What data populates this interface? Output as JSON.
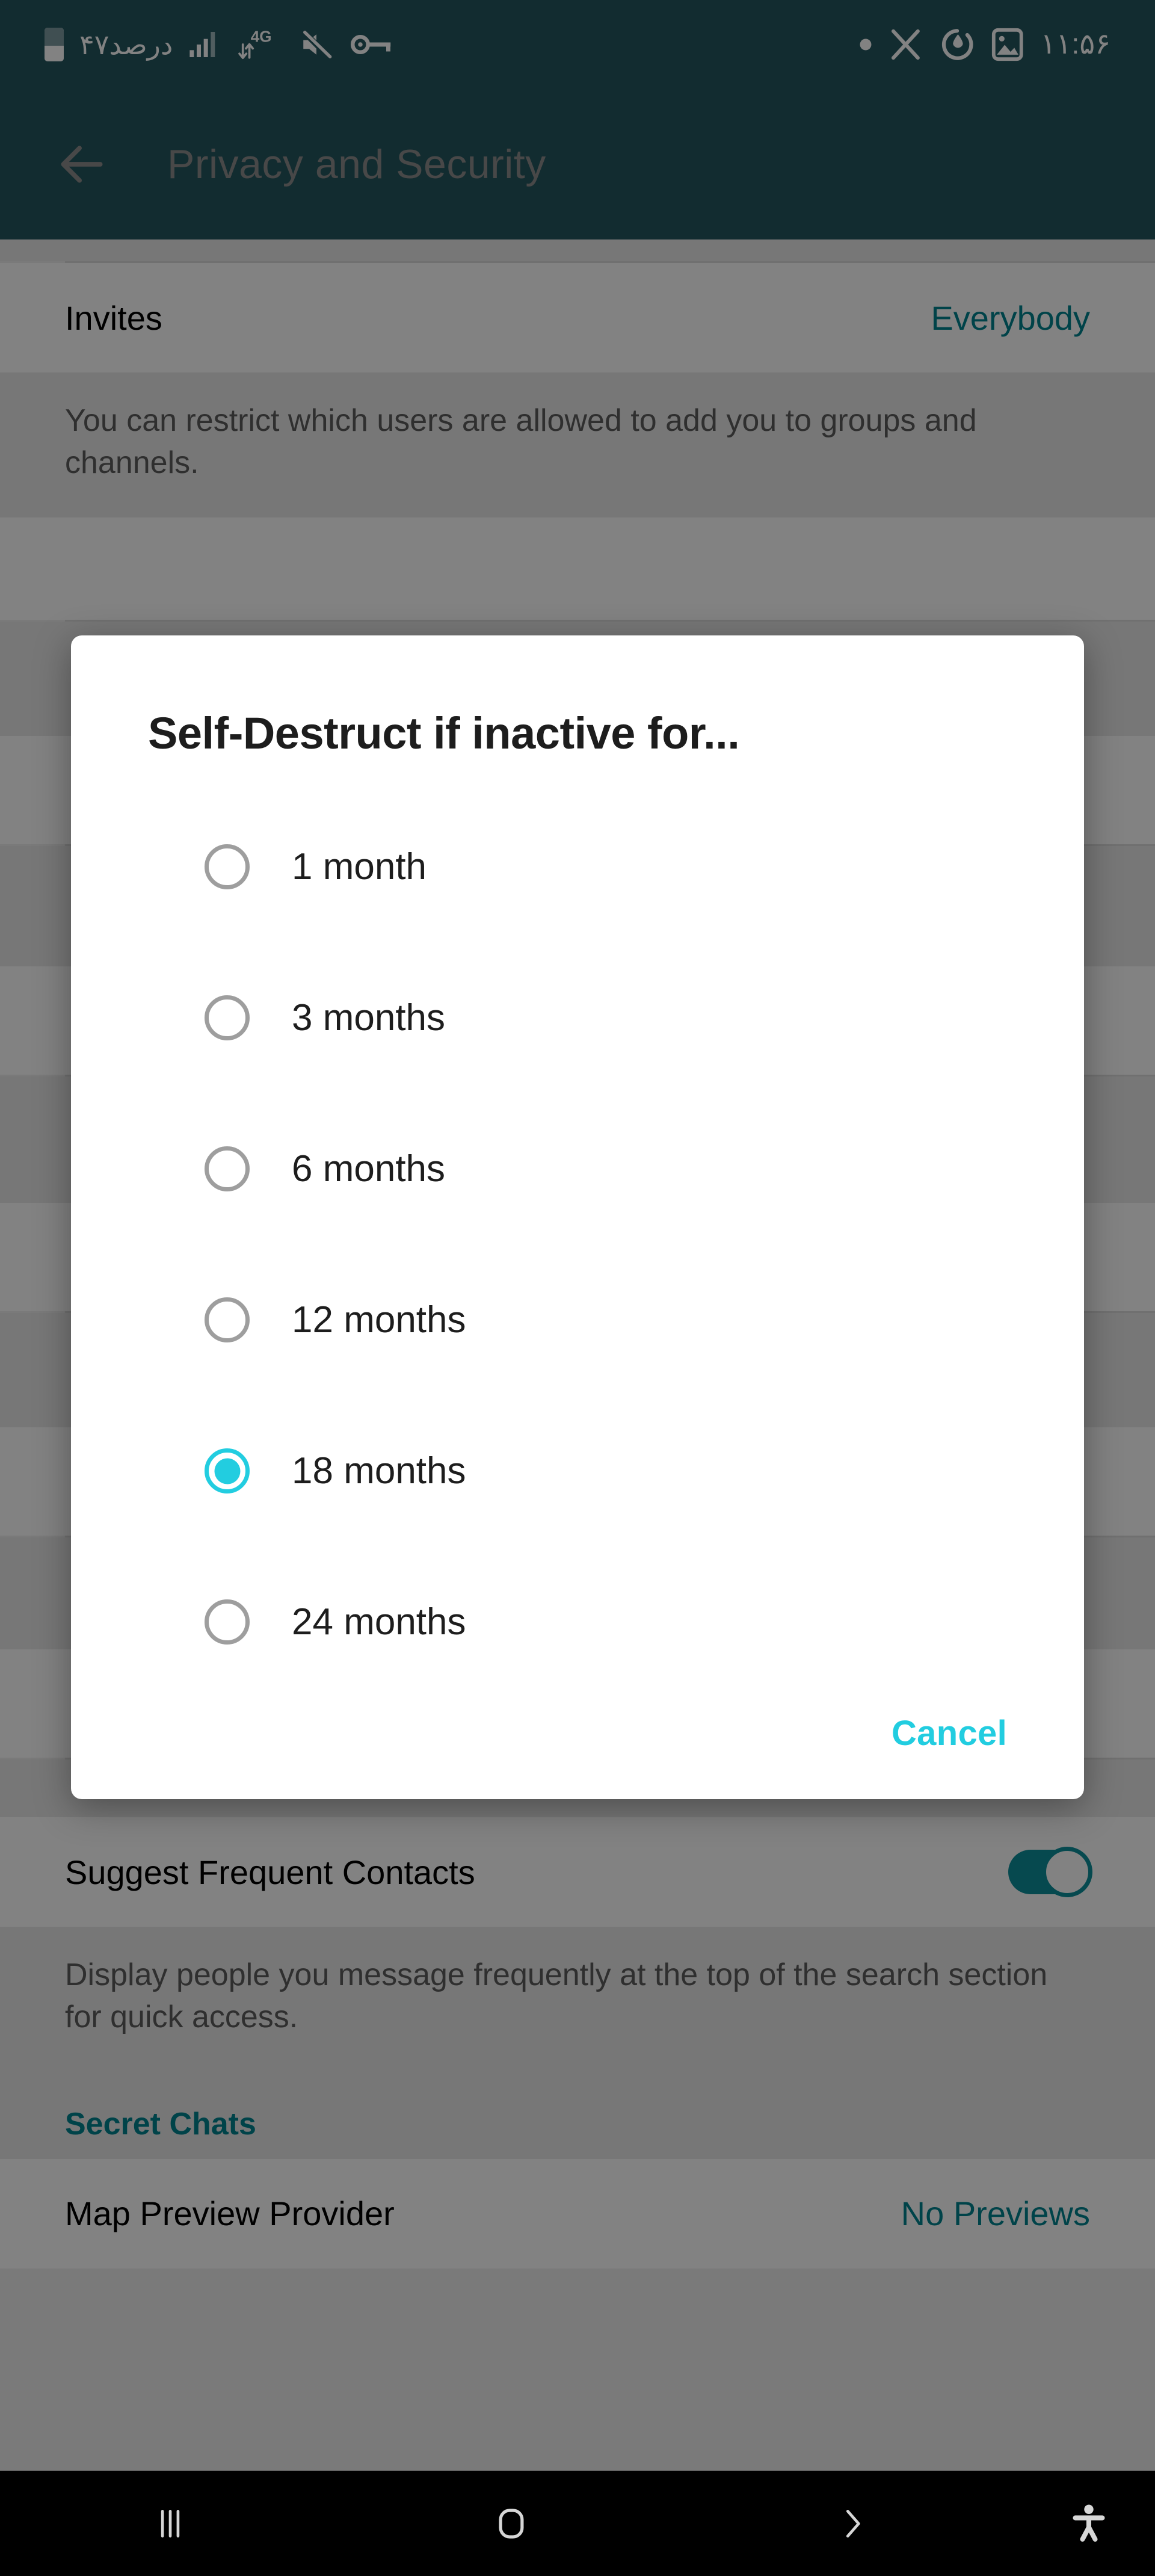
{
  "statusbar": {
    "battery_text": "۴۷درصد",
    "network_label": "4G",
    "icons": [
      "battery-icon",
      "signal-bars-icon",
      "mobile-data-4g-icon",
      "mute-icon",
      "vpn-key-icon",
      "notification-dot-icon",
      "x-app-icon",
      "power-saving-icon",
      "screenshot-image-icon"
    ],
    "time": "۱۱:۵۶"
  },
  "appbar": {
    "back_label": "back-arrow",
    "title": "Privacy and Security"
  },
  "settings": {
    "invites_row": {
      "title": "Invites",
      "value": "Everybody"
    },
    "invites_desc": "You can restrict which users are allowed to add you to groups and channels.",
    "suggest_row": {
      "title": "Suggest Frequent Contacts",
      "toggle_state": "on"
    },
    "suggest_desc": "Display people you message frequently at the top of the search section for quick access.",
    "secret_chats_header": "Secret Chats",
    "map_preview_row": {
      "title": "Map Preview Provider",
      "value": "No Previews"
    }
  },
  "dialog": {
    "title": "Self-Destruct if inactive for...",
    "options": [
      {
        "label": "1 month",
        "selected": false
      },
      {
        "label": "3 months",
        "selected": false
      },
      {
        "label": "6 months",
        "selected": false
      },
      {
        "label": "12 months",
        "selected": false
      },
      {
        "label": "18 months",
        "selected": true
      },
      {
        "label": "24 months",
        "selected": false
      }
    ],
    "cancel_label": "Cancel"
  },
  "navbar": {
    "recents_label": "recent-apps-icon",
    "home_label": "home-icon",
    "back_label": "back-chevron-icon",
    "accessibility_label": "accessibility-icon"
  },
  "colors": {
    "appbar_bg": "#24565e",
    "accent_teal": "#00838f",
    "accent_cyan": "#22cde0",
    "toggle_on": "#0c8f9c"
  }
}
